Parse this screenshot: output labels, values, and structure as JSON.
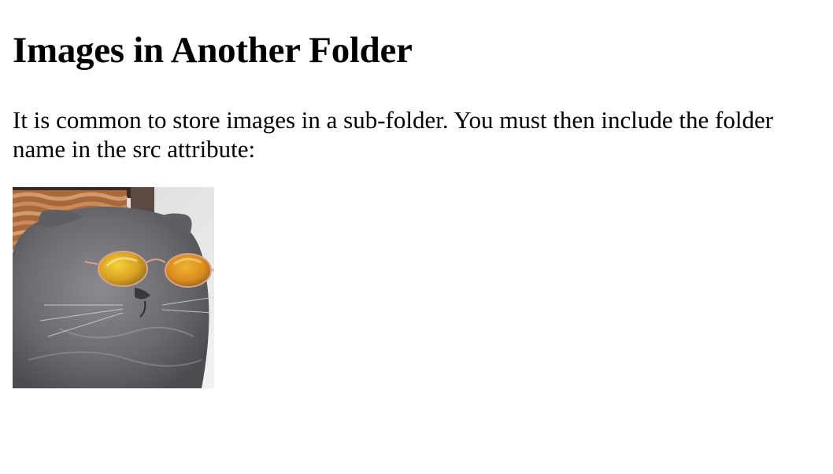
{
  "heading": "Images in Another Folder",
  "paragraph": "It is common to store images in a sub-folder. You must then include the folder name in the src attribute:",
  "image": {
    "subject": "gray cat wearing round yellow-tinted sunglasses",
    "colors": {
      "background": "#e8e8ea",
      "basket": "#b4744a",
      "fur": "#6e6e72",
      "lens": "#e3b22b"
    }
  }
}
